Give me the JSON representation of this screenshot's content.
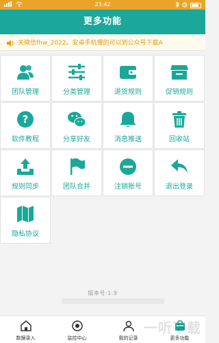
{
  "status_bar": {
    "time": "23:42"
  },
  "header": {
    "title": "更多功能"
  },
  "notice": {
    "text": "关微信fhw_2022。安卓手机慢的可以到公众号下载A"
  },
  "menu": [
    {
      "label": "团队管理",
      "icon": "team-icon"
    },
    {
      "label": "分类管理",
      "icon": "sliders-icon"
    },
    {
      "label": "退货规则",
      "icon": "wallet-icon"
    },
    {
      "label": "促销规则",
      "icon": "store-icon"
    },
    {
      "label": "软件教程",
      "icon": "help-icon"
    },
    {
      "label": "分享好友",
      "icon": "wechat-icon"
    },
    {
      "label": "消息推送",
      "icon": "bell-icon"
    },
    {
      "label": "回收站",
      "icon": "trash-icon"
    },
    {
      "label": "规则同步",
      "icon": "upload-icon"
    },
    {
      "label": "团队合并",
      "icon": "flag-icon"
    },
    {
      "label": "注销账号",
      "icon": "minus-circle-icon"
    },
    {
      "label": "退出登录",
      "icon": "reply-icon"
    },
    {
      "label": "隐私协议",
      "icon": "map-icon"
    }
  ],
  "footer": {
    "version": "版本号:1.9"
  },
  "bottom_nav": [
    {
      "label": "数据录入",
      "icon": "home-icon"
    },
    {
      "label": "监控中心",
      "icon": "target-icon"
    },
    {
      "label": "我的记录",
      "icon": "user-icon"
    },
    {
      "label": "更多功能",
      "icon": "bag-icon"
    }
  ],
  "watermark": {
    "text": "一听下载"
  },
  "colors": {
    "accent": "#1ba89a",
    "status_bar": "#e9a52a",
    "notice_text": "#e49b0f"
  }
}
